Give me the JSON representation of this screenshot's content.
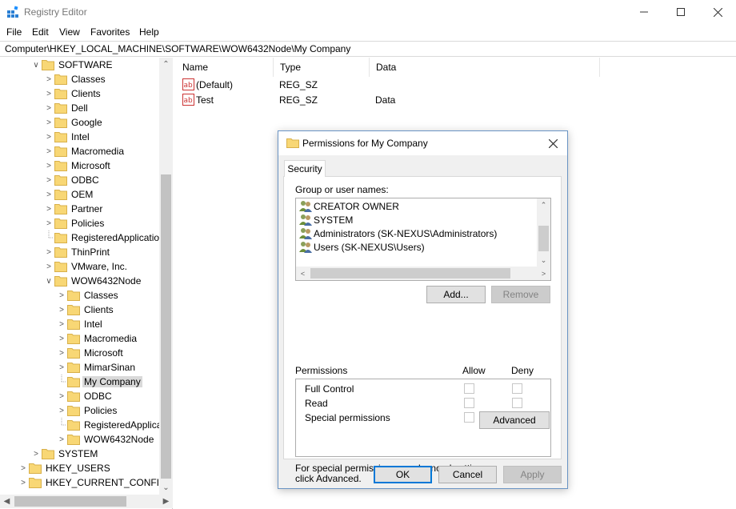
{
  "window": {
    "title": "Registry Editor"
  },
  "menu": [
    "File",
    "Edit",
    "View",
    "Favorites",
    "Help"
  ],
  "address": "Computer\\HKEY_LOCAL_MACHINE\\SOFTWARE\\WOW6432Node\\My Company",
  "tree": [
    {
      "label": "SOFTWARE",
      "level": 0,
      "expanded": true
    },
    {
      "label": "Classes",
      "level": 1
    },
    {
      "label": "Clients",
      "level": 1
    },
    {
      "label": "Dell",
      "level": 1
    },
    {
      "label": "Google",
      "level": 1
    },
    {
      "label": "Intel",
      "level": 1
    },
    {
      "label": "Macromedia",
      "level": 1
    },
    {
      "label": "Microsoft",
      "level": 1
    },
    {
      "label": "ODBC",
      "level": 1
    },
    {
      "label": "OEM",
      "level": 1
    },
    {
      "label": "Partner",
      "level": 1
    },
    {
      "label": "Policies",
      "level": 1
    },
    {
      "label": "RegisteredApplicatio",
      "level": 1,
      "leaf": true
    },
    {
      "label": "ThinPrint",
      "level": 1
    },
    {
      "label": "VMware, Inc.",
      "level": 1
    },
    {
      "label": "WOW6432Node",
      "level": 1,
      "expanded": true
    },
    {
      "label": "Classes",
      "level": 2
    },
    {
      "label": "Clients",
      "level": 2
    },
    {
      "label": "Intel",
      "level": 2
    },
    {
      "label": "Macromedia",
      "level": 2
    },
    {
      "label": "Microsoft",
      "level": 2
    },
    {
      "label": "MimarSinan",
      "level": 2
    },
    {
      "label": "My Company",
      "level": 2,
      "leaf": true,
      "selected": true
    },
    {
      "label": "ODBC",
      "level": 2
    },
    {
      "label": "Policies",
      "level": 2
    },
    {
      "label": "RegisteredApplica",
      "level": 2,
      "leaf": true
    },
    {
      "label": "WOW6432Node",
      "level": 2
    },
    {
      "label": "SYSTEM",
      "level": 0
    },
    {
      "label": "HKEY_USERS",
      "level": -1
    },
    {
      "label": "HKEY_CURRENT_CONFIG",
      "level": -1
    }
  ],
  "list": {
    "columns": [
      "Name",
      "Type",
      "Data"
    ],
    "rows": [
      {
        "name": "(Default)",
        "type": "REG_SZ",
        "data": ""
      },
      {
        "name": "Test",
        "type": "REG_SZ",
        "data": "Data"
      }
    ]
  },
  "dialog": {
    "title": "Permissions for My Company",
    "tab": "Security",
    "group_label": "Group or user names:",
    "users": [
      "CREATOR OWNER",
      "SYSTEM",
      "Administrators (SK-NEXUS\\Administrators)",
      "Users (SK-NEXUS\\Users)"
    ],
    "add_label": "Add...",
    "remove_label": "Remove",
    "permissions_label": "Permissions",
    "allow_label": "Allow",
    "deny_label": "Deny",
    "permissions": [
      "Full Control",
      "Read",
      "Special permissions"
    ],
    "advanced_text_1": "For special permissions or advanced settings,",
    "advanced_text_2": "click Advanced.",
    "advanced_label": "Advanced",
    "ok_label": "OK",
    "cancel_label": "Cancel",
    "apply_label": "Apply"
  }
}
